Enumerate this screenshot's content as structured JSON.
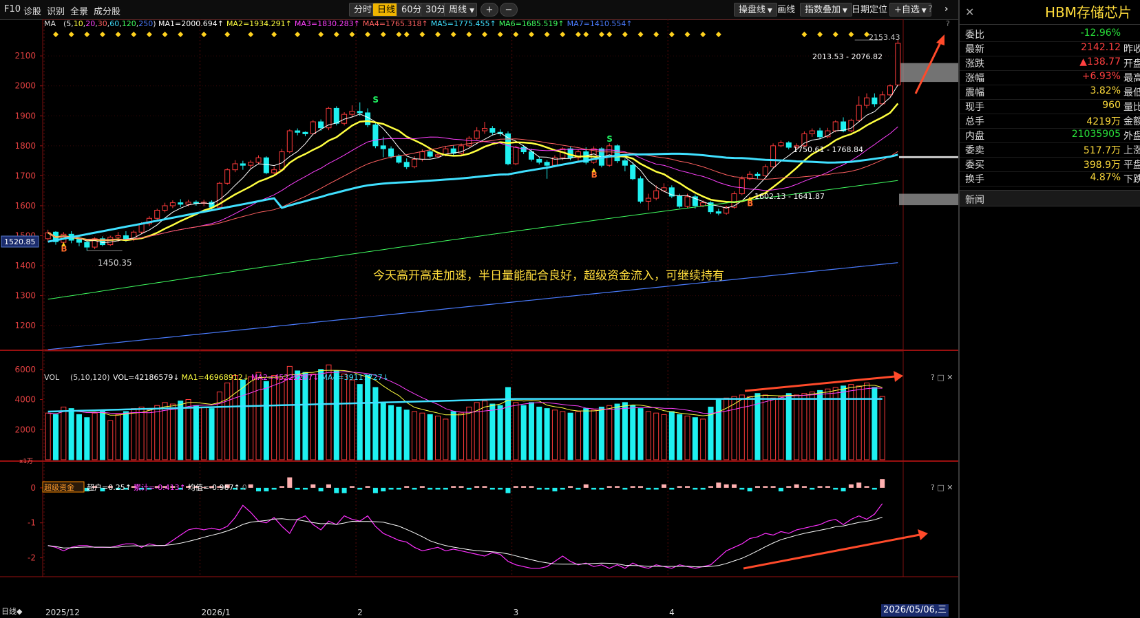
{
  "toolbar": {
    "f10": "F10",
    "nav_items": [
      "诊股",
      "识别",
      "全景",
      "成分股"
    ],
    "periods": [
      "分时",
      "日线",
      "60分",
      "30分",
      "周线"
    ],
    "active_period": "日线",
    "zoom_in": "+",
    "zoom_out": "−",
    "right_items": [
      "操盘线",
      "画线",
      "指数叠加",
      "日期定位",
      "+自选"
    ]
  },
  "ma_legend": {
    "head": "MA",
    "params": [
      "5",
      "10",
      "20",
      "30",
      "60",
      "120",
      "250"
    ],
    "items": [
      "MA1=2000.694↑",
      "MA2=1934.291↑",
      "MA3=1830.283↑",
      "MA4=1765.318↑",
      "MA5=1775.455↑",
      "MA6=1685.519↑",
      "MA7=1410.554↑"
    ]
  },
  "vol_legend": {
    "head": "VOL",
    "params": "(5,10,120)",
    "items": [
      "VOL=42186579↓",
      "MA1=46968912↓",
      "MA2=45222297↓",
      "MA4=39117727↓"
    ]
  },
  "fund_legend": {
    "head": "超级资金",
    "items": [
      "超户=0.25↑",
      "累计=-0.413↑",
      "均值=-0.967↑",
      "0"
    ]
  },
  "annotations": {
    "main_text": "今天高开高走加速，半日量能配合良好，超级资金流入，可继续持有",
    "high_label": "2153.43",
    "zone_top_label": "2013.53 - 2076.82",
    "zone_mid_label": "1750.61 - 1768.84",
    "zone_low_label": "1602.13 - 1641.87",
    "low_label": "1450.35",
    "price_tag": "1520.85",
    "vol_unit": "x1万",
    "b_marker": "B",
    "s_marker": "S"
  },
  "bottom": {
    "period_label": "日线◆",
    "date_readout": "2026/05/06,三",
    "x_labels": [
      "2025/12",
      "2026/1",
      "2",
      "3",
      "4"
    ]
  },
  "quote_panel": {
    "title": "HBM存储芯片",
    "rows": [
      {
        "label": "委比",
        "value": "-12.96%",
        "color": "#29e03a",
        "next": ""
      },
      {
        "label": "最新",
        "value": "2142.12",
        "color": "#ff4040",
        "next": "昨收"
      },
      {
        "label": "涨跌",
        "value": "▲138.77",
        "color": "#ff4040",
        "next": "开盘"
      },
      {
        "label": "涨幅",
        "value": "+6.93%",
        "color": "#ff4040",
        "next": "最高"
      },
      {
        "label": "震幅",
        "value": "3.82%",
        "color": "#ffdc3c",
        "next": "最低"
      },
      {
        "label": "现手",
        "value": "960",
        "color": "#ffdc3c",
        "next": "量比"
      },
      {
        "label": "总手",
        "value": "4219万",
        "color": "#ffdc3c",
        "next": "金额"
      },
      {
        "label": "内盘",
        "value": "21035905",
        "color": "#29e03a",
        "next": "外盘"
      },
      {
        "label": "委卖",
        "value": "517.7万",
        "color": "#ffdc3c",
        "next": "上涨"
      },
      {
        "label": "委买",
        "value": "398.9万",
        "color": "#ffdc3c",
        "next": "平盘"
      },
      {
        "label": "换手",
        "value": "4.87%",
        "color": "#ffdc3c",
        "next": "下跌"
      }
    ],
    "news_label": "新闻"
  },
  "chart_data": {
    "type": "candlestick",
    "price_axis": {
      "ticks": [
        1200,
        1300,
        1400,
        1500,
        1600,
        1700,
        1800,
        1900,
        2000,
        2100
      ],
      "ylim": [
        1120,
        2190
      ]
    },
    "volume_axis": {
      "unit": "x1万",
      "ticks": [
        2000,
        4000,
        6000
      ],
      "ylim": [
        0,
        6400
      ]
    },
    "fund_axis": {
      "ticks": [
        0,
        -1,
        -2
      ],
      "ylim": [
        -2.5,
        0.45
      ]
    },
    "candles": [
      [
        1490,
        1510,
        1478,
        1520
      ],
      [
        1512,
        1480,
        1470,
        1515
      ],
      [
        1478,
        1505,
        1472,
        1512
      ],
      [
        1505,
        1485,
        1475,
        1515
      ],
      [
        1488,
        1478,
        1465,
        1495
      ],
      [
        1478,
        1462,
        1450,
        1488
      ],
      [
        1462,
        1490,
        1455,
        1495
      ],
      [
        1490,
        1470,
        1465,
        1498
      ],
      [
        1470,
        1495,
        1466,
        1500
      ],
      [
        1495,
        1500,
        1480,
        1512
      ],
      [
        1500,
        1485,
        1480,
        1515
      ],
      [
        1488,
        1512,
        1482,
        1518
      ],
      [
        1512,
        1540,
        1505,
        1545
      ],
      [
        1540,
        1558,
        1532,
        1565
      ],
      [
        1558,
        1585,
        1552,
        1590
      ],
      [
        1585,
        1600,
        1578,
        1610
      ],
      [
        1600,
        1610,
        1592,
        1618
      ],
      [
        1610,
        1605,
        1595,
        1622
      ],
      [
        1605,
        1612,
        1598,
        1620
      ],
      [
        1612,
        1608,
        1600,
        1618
      ],
      [
        1608,
        1612,
        1598,
        1620
      ],
      [
        1612,
        1595,
        1588,
        1618
      ],
      [
        1595,
        1675,
        1592,
        1680
      ],
      [
        1675,
        1720,
        1670,
        1725
      ],
      [
        1720,
        1740,
        1712,
        1752
      ],
      [
        1740,
        1735,
        1720,
        1750
      ],
      [
        1735,
        1745,
        1725,
        1752
      ],
      [
        1745,
        1760,
        1738,
        1768
      ],
      [
        1760,
        1710,
        1705,
        1765
      ],
      [
        1710,
        1720,
        1705,
        1730
      ],
      [
        1720,
        1780,
        1715,
        1790
      ],
      [
        1780,
        1850,
        1775,
        1855
      ],
      [
        1850,
        1845,
        1835,
        1858
      ],
      [
        1845,
        1840,
        1832,
        1848
      ],
      [
        1840,
        1880,
        1836,
        1886
      ],
      [
        1880,
        1860,
        1850,
        1888
      ],
      [
        1860,
        1925,
        1852,
        1930
      ],
      [
        1925,
        1875,
        1868,
        1932
      ],
      [
        1875,
        1905,
        1868,
        1912
      ],
      [
        1905,
        1915,
        1895,
        1935
      ],
      [
        1915,
        1910,
        1900,
        1945
      ],
      [
        1910,
        1870,
        1862,
        1925
      ],
      [
        1870,
        1800,
        1792,
        1878
      ],
      [
        1800,
        1790,
        1762,
        1830
      ],
      [
        1790,
        1765,
        1758,
        1798
      ],
      [
        1765,
        1745,
        1740,
        1772
      ],
      [
        1745,
        1730,
        1722,
        1758
      ],
      [
        1730,
        1755,
        1725,
        1765
      ],
      [
        1755,
        1780,
        1748,
        1788
      ],
      [
        1780,
        1765,
        1758,
        1790
      ],
      [
        1765,
        1770,
        1760,
        1778
      ],
      [
        1770,
        1790,
        1765,
        1798
      ],
      [
        1790,
        1775,
        1768,
        1802
      ],
      [
        1775,
        1800,
        1770,
        1808
      ],
      [
        1800,
        1825,
        1795,
        1832
      ],
      [
        1825,
        1850,
        1820,
        1862
      ],
      [
        1850,
        1858,
        1840,
        1880
      ],
      [
        1858,
        1845,
        1835,
        1866
      ],
      [
        1845,
        1840,
        1832,
        1855
      ],
      [
        1840,
        1740,
        1735,
        1848
      ],
      [
        1740,
        1795,
        1735,
        1800
      ],
      [
        1795,
        1780,
        1772,
        1802
      ],
      [
        1780,
        1755,
        1748,
        1790
      ],
      [
        1755,
        1745,
        1738,
        1762
      ],
      [
        1745,
        1735,
        1690,
        1752
      ],
      [
        1735,
        1760,
        1728,
        1768
      ],
      [
        1760,
        1790,
        1752,
        1795
      ],
      [
        1790,
        1760,
        1752,
        1798
      ],
      [
        1760,
        1780,
        1750,
        1788
      ],
      [
        1780,
        1745,
        1738,
        1795
      ],
      [
        1745,
        1790,
        1740,
        1798
      ],
      [
        1790,
        1735,
        1728,
        1795
      ],
      [
        1735,
        1800,
        1730,
        1808
      ],
      [
        1800,
        1750,
        1742,
        1805
      ],
      [
        1750,
        1735,
        1715,
        1758
      ],
      [
        1735,
        1690,
        1685,
        1745
      ],
      [
        1690,
        1615,
        1608,
        1698
      ],
      [
        1615,
        1625,
        1585,
        1640
      ],
      [
        1625,
        1650,
        1618,
        1668
      ],
      [
        1650,
        1660,
        1645,
        1675
      ],
      [
        1660,
        1632,
        1625,
        1668
      ],
      [
        1632,
        1598,
        1592,
        1640
      ],
      [
        1598,
        1630,
        1592,
        1640
      ],
      [
        1630,
        1600,
        1590,
        1638
      ],
      [
        1600,
        1610,
        1595,
        1618
      ],
      [
        1610,
        1580,
        1572,
        1615
      ],
      [
        1580,
        1575,
        1568,
        1590
      ],
      [
        1575,
        1595,
        1570,
        1600
      ],
      [
        1595,
        1640,
        1590,
        1648
      ],
      [
        1640,
        1690,
        1635,
        1698
      ],
      [
        1690,
        1705,
        1685,
        1715
      ],
      [
        1705,
        1700,
        1690,
        1712
      ],
      [
        1700,
        1730,
        1695,
        1738
      ],
      [
        1730,
        1800,
        1725,
        1808
      ],
      [
        1800,
        1810,
        1795,
        1818
      ],
      [
        1810,
        1795,
        1788,
        1815
      ],
      [
        1795,
        1800,
        1790,
        1808
      ],
      [
        1800,
        1840,
        1795,
        1848
      ],
      [
        1840,
        1850,
        1830,
        1858
      ],
      [
        1850,
        1830,
        1822,
        1860
      ],
      [
        1830,
        1850,
        1825,
        1860
      ],
      [
        1850,
        1880,
        1845,
        1885
      ],
      [
        1880,
        1850,
        1845,
        1895
      ],
      [
        1850,
        1885,
        1845,
        1890
      ],
      [
        1885,
        1935,
        1880,
        1965
      ],
      [
        1935,
        1960,
        1925,
        1975
      ],
      [
        1960,
        1940,
        1930,
        1975
      ],
      [
        1940,
        1970,
        1935,
        1982
      ],
      [
        1970,
        2000,
        1965,
        2005
      ],
      [
        2003,
        2142,
        2000,
        2153
      ]
    ],
    "volume": [
      3100,
      3000,
      3500,
      3400,
      3000,
      2800,
      3100,
      3300,
      2600,
      3000,
      3200,
      3400,
      3500,
      3300,
      3600,
      3800,
      3700,
      3900,
      4000,
      3600,
      3500,
      3400,
      4500,
      5100,
      5600,
      5300,
      5500,
      5800,
      5200,
      5600,
      5400,
      6200,
      5900,
      5800,
      5700,
      6000,
      6300,
      5900,
      5700,
      5300,
      5000,
      5600,
      4800,
      3800,
      3600,
      3500,
      3300,
      3200,
      3100,
      3000,
      2900,
      2700,
      3200,
      3100,
      3500,
      3800,
      3900,
      3700,
      3600,
      4800,
      3800,
      3600,
      3800,
      3500,
      3400,
      3300,
      3200,
      3100,
      3200,
      3400,
      3300,
      3500,
      3600,
      3700,
      3800,
      3600,
      3400,
      3200,
      3100,
      3000,
      3200,
      3000,
      2900,
      2800,
      2700,
      3500,
      4000,
      4100,
      4200,
      4300,
      4200,
      4400,
      4300,
      4100,
      4200,
      4400,
      4300,
      4400,
      4500,
      4600,
      4700,
      4800,
      4900,
      5000,
      4900,
      5100,
      4800,
      4200
    ],
    "fund_bars": [
      -0.05,
      -0.05,
      -0.05,
      -0.05,
      0.05,
      -0.1,
      0.05,
      -0.1,
      0.05,
      -0.05,
      -0.05,
      0.05,
      -0.05,
      -0.05,
      0.05,
      0.05,
      0.05,
      -0.05,
      0.05,
      0.05,
      0.02,
      0.05,
      0.05,
      0.1,
      -0.05,
      -0.05,
      0.1,
      -0.1,
      -0.1,
      -0.05,
      0.05,
      0.3,
      -0.05,
      -0.05,
      0.1,
      -0.1,
      0.1,
      -0.15,
      -0.15,
      0.05,
      -0.05,
      0.05,
      -0.15,
      -0.1,
      -0.05,
      -0.05,
      0.05,
      -0.05,
      0.05,
      -0.05,
      -0.05,
      -0.05,
      0.05,
      0.05,
      -0.05,
      0.05,
      0.05,
      -0.05,
      -0.05,
      -0.15,
      0.05,
      0.05,
      0.05,
      -0.05,
      -0.05,
      -0.1,
      -0.05,
      0.05,
      -0.05,
      0.1,
      -0.05,
      -0.05,
      0.05,
      0.05,
      -0.05,
      0.05,
      0.05,
      -0.05,
      -0.05,
      0.1,
      -0.05,
      0.05,
      0.05,
      -0.05,
      -0.05,
      0.05,
      0.15,
      0.1,
      0.1,
      -0.05,
      -0.1,
      0.05,
      0.05,
      0.05,
      -0.1,
      0.05,
      0.1,
      0.05,
      -0.05,
      0.05,
      0.05,
      -0.05,
      -0.1,
      0.1,
      0.15,
      0.05,
      -0.05,
      0.25
    ],
    "fund_cumulative": [
      -1.65,
      -1.7,
      -1.8,
      -1.7,
      -1.65,
      -1.65,
      -1.7,
      -1.7,
      -1.7,
      -1.65,
      -1.6,
      -1.6,
      -1.7,
      -1.6,
      -1.65,
      -1.65,
      -1.5,
      -1.35,
      -1.2,
      -1.15,
      -1.2,
      -1.15,
      -1.2,
      -1.1,
      -0.85,
      -0.5,
      -0.7,
      -0.95,
      -1.0,
      -0.85,
      -1.1,
      -1.3,
      -0.9,
      -0.8,
      -1.05,
      -1.2,
      -0.95,
      -1.05,
      -0.8,
      -0.9,
      -0.95,
      -0.8,
      -1.1,
      -1.3,
      -1.4,
      -1.5,
      -1.55,
      -1.7,
      -1.8,
      -1.75,
      -1.7,
      -1.8,
      -1.75,
      -1.8,
      -1.85,
      -1.9,
      -1.95,
      -1.85,
      -1.9,
      -2.1,
      -2.2,
      -2.25,
      -2.3,
      -2.3,
      -2.25,
      -2.1,
      -1.95,
      -2.1,
      -2.2,
      -2.15,
      -2.25,
      -2.2,
      -2.3,
      -2.2,
      -2.3,
      -2.15,
      -2.25,
      -2.3,
      -2.2,
      -2.25,
      -2.3,
      -2.2,
      -2.25,
      -2.3,
      -2.25,
      -2.2,
      -2.0,
      -1.8,
      -1.7,
      -1.6,
      -1.45,
      -1.4,
      -1.3,
      -1.35,
      -1.25,
      -1.3,
      -1.2,
      -1.15,
      -1.1,
      -1.05,
      -0.95,
      -0.9,
      -1.05,
      -0.9,
      -0.8,
      -0.9,
      -0.75,
      -0.45
    ],
    "xlim_index": [
      0,
      107
    ],
    "x_labels_at": [
      0,
      20,
      40,
      60,
      80
    ]
  }
}
